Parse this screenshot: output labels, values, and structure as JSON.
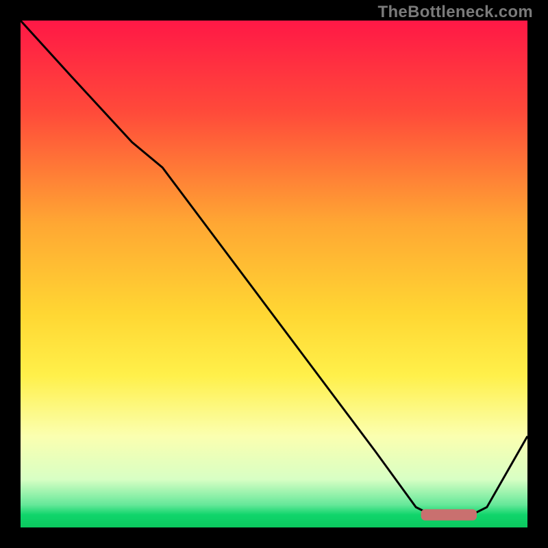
{
  "watermark": "TheBottleneck.com",
  "chart_data": {
    "type": "line",
    "title": "",
    "xlabel": "",
    "ylabel": "",
    "xlim": [
      0,
      100
    ],
    "ylim": [
      0,
      100
    ],
    "grid": false,
    "legend": false,
    "background_gradient_stops": [
      {
        "offset": 0.0,
        "color": "#ff1846"
      },
      {
        "offset": 0.18,
        "color": "#ff4a3a"
      },
      {
        "offset": 0.4,
        "color": "#ffa733"
      },
      {
        "offset": 0.58,
        "color": "#ffd733"
      },
      {
        "offset": 0.7,
        "color": "#fff04a"
      },
      {
        "offset": 0.82,
        "color": "#fbffb0"
      },
      {
        "offset": 0.905,
        "color": "#d8ffc4"
      },
      {
        "offset": 0.955,
        "color": "#66e89a"
      },
      {
        "offset": 0.975,
        "color": "#10d56b"
      },
      {
        "offset": 1.0,
        "color": "#0bc95f"
      }
    ],
    "series": [
      {
        "name": "bottleneck-curve",
        "color": "#000000",
        "x": [
          0,
          10,
          22,
          28,
          40,
          55,
          70,
          78,
          82,
          88,
          92,
          100
        ],
        "y": [
          100,
          89,
          76,
          71,
          55,
          35,
          15,
          4,
          2,
          2,
          4,
          18
        ]
      }
    ],
    "marker": {
      "name": "optimal-range-marker",
      "color": "#c9706f",
      "x_start": 79,
      "x_end": 90,
      "y": 2.5,
      "thickness": 2.2
    }
  }
}
